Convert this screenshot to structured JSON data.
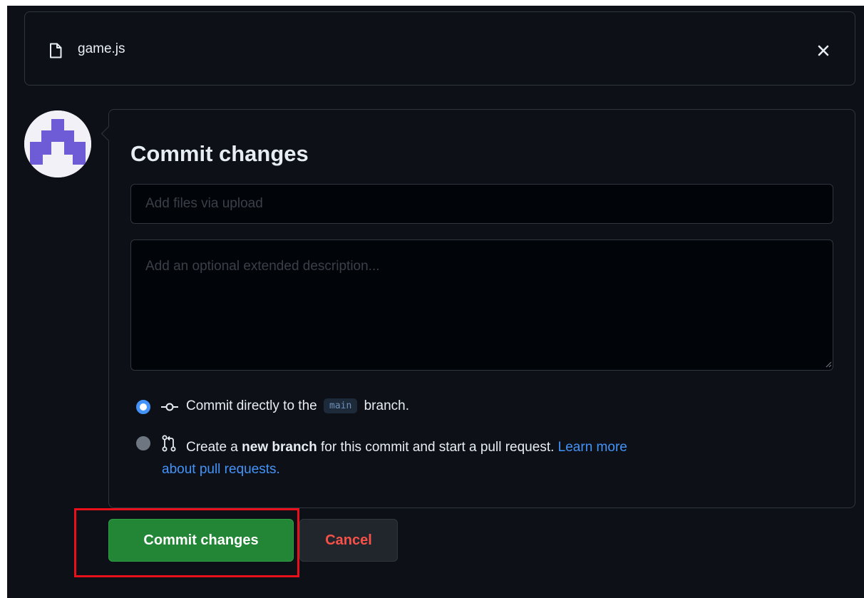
{
  "file_bar": {
    "file_name": "game.js",
    "file_icon": "file-icon",
    "close_icon": "close-icon"
  },
  "avatar": {
    "icon": "identicon-avatar"
  },
  "commit_form": {
    "title": "Commit changes",
    "summary_placeholder": "Add files via upload",
    "summary_value": "",
    "description_placeholder": "Add an optional extended description...",
    "description_value": ""
  },
  "options": {
    "direct": {
      "selected": true,
      "icon": "git-commit-icon",
      "prefix": "Commit directly to the",
      "branch": "main",
      "suffix": "branch."
    },
    "new_branch": {
      "selected": false,
      "icon": "git-pull-request-icon",
      "prefix": "Create a",
      "bold": "new branch",
      "middle": "for this commit and start a pull request.",
      "link_line1": "Learn more",
      "link_line2": "about pull requests."
    }
  },
  "buttons": {
    "commit_label": "Commit changes",
    "cancel_label": "Cancel"
  },
  "colors": {
    "background": "#0d1117",
    "border": "#30363d",
    "primary_green": "#238636",
    "danger_red": "#f85149",
    "link_blue": "#4493f8",
    "highlight_red": "#e8101a"
  }
}
